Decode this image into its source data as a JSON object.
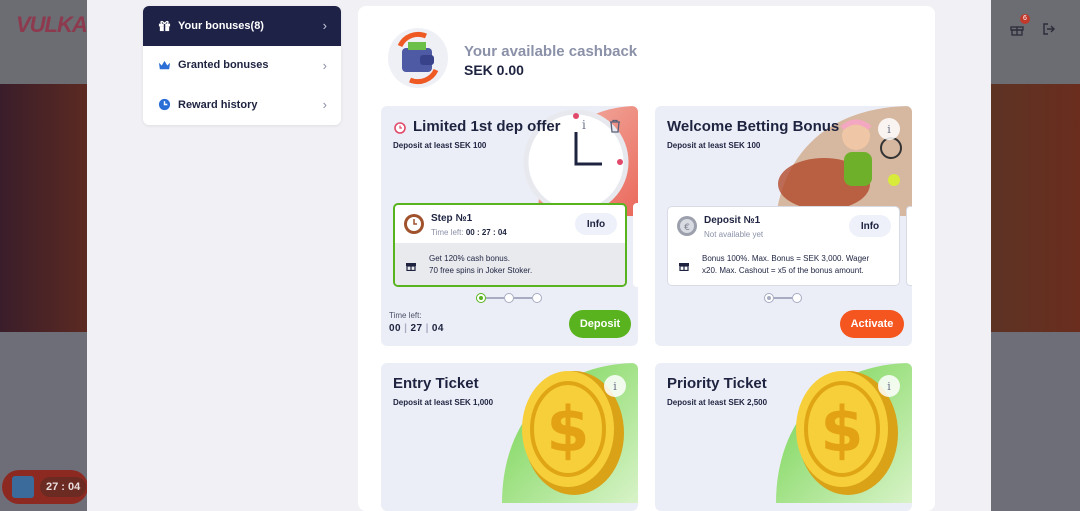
{
  "brand": {
    "logo_text": "VULKAN"
  },
  "background": {
    "notification_count": "6",
    "timer": "27 : 04"
  },
  "menu": {
    "items": [
      {
        "label": "Your bonuses",
        "count": "(8)",
        "active": true
      },
      {
        "label": "Granted bonuses",
        "active": false
      },
      {
        "label": "Reward history",
        "active": false
      }
    ]
  },
  "cashback": {
    "label": "Your available cashback",
    "value": "SEK 0.00"
  },
  "cards": [
    {
      "title": "Limited 1st dep offer",
      "subtitle": "Deposit at least SEK 100",
      "step": {
        "name": "Step №1",
        "time_label": "Time left:",
        "time": "00 : 27 : 04",
        "info": "Info",
        "desc_line1": "Get 120% cash bonus.",
        "desc_line2": "70 free spins in Joker Stoker."
      },
      "time_left_label": "Time left:",
      "time_left": {
        "h": "00",
        "m": "27",
        "s": "04"
      },
      "button": "Deposit"
    },
    {
      "title": "Welcome Betting Bonus",
      "subtitle": "Deposit at least SEK 100",
      "step": {
        "name": "Deposit №1",
        "status": "Not available yet",
        "info": "Info",
        "desc_line1": "Bonus 100%. Max. Bonus = SEK 3,000. Wager",
        "desc_line2": "x20. Max. Cashout = x5 of the bonus amount."
      },
      "button": "Activate"
    },
    {
      "title": "Entry Ticket",
      "subtitle": "Deposit at least SEK 1,000"
    },
    {
      "title": "Priority Ticket",
      "subtitle": "Deposit at least SEK 2,500"
    }
  ],
  "colors": {
    "accent_green": "#58b31e",
    "accent_orange": "#f5561f",
    "navy": "#1f2247"
  }
}
